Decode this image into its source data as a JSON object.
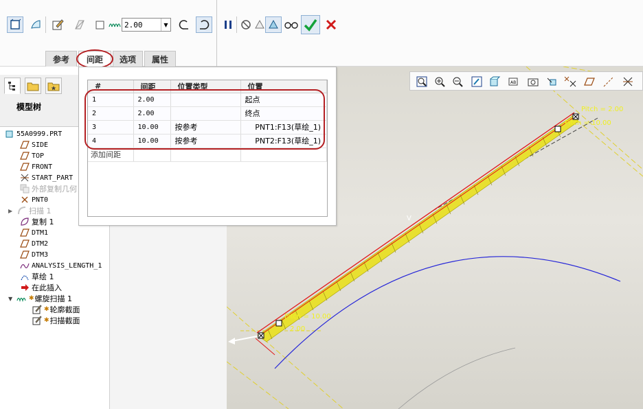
{
  "dashboard": {
    "pitch_value": "2.00",
    "tabs": [
      {
        "label": "参考"
      },
      {
        "label": "间距"
      },
      {
        "label": "选项"
      },
      {
        "label": "属性"
      }
    ]
  },
  "model_tree": {
    "title": "模型树",
    "items": [
      {
        "label": "55A0999.PRT",
        "icon": "part-icon"
      },
      {
        "label": "SIDE",
        "icon": "datum-plane-icon"
      },
      {
        "label": "TOP",
        "icon": "datum-plane-icon"
      },
      {
        "label": "FRONT",
        "icon": "datum-plane-icon"
      },
      {
        "label": "START_PART",
        "icon": "coordinate-system-icon"
      },
      {
        "label": "外部复制几何",
        "icon": "copy-geometry-icon"
      },
      {
        "label": "PNT0",
        "icon": "datum-point-icon"
      },
      {
        "label": "扫描 1",
        "icon": "sweep-icon"
      },
      {
        "label": "复制 1",
        "icon": "copy-icon"
      },
      {
        "label": "DTM1",
        "icon": "datum-plane-icon"
      },
      {
        "label": "DTM2",
        "icon": "datum-plane-icon"
      },
      {
        "label": "DTM3",
        "icon": "datum-plane-icon"
      },
      {
        "label": "ANALYSIS_LENGTH_1",
        "icon": "analysis-icon"
      },
      {
        "label": "草绘 1",
        "icon": "sketch-icon"
      },
      {
        "label": "在此插入",
        "icon": "insert-here-icon"
      },
      {
        "label": "螺旋扫描 1",
        "icon": "helical-sweep-icon"
      },
      {
        "label": "轮廓截面",
        "icon": "sketch-edit-icon"
      },
      {
        "label": "扫描截面",
        "icon": "sketch-edit-icon"
      }
    ]
  },
  "spacing_panel": {
    "columns": [
      "#",
      "间距",
      "位置类型",
      "位置"
    ],
    "rows": [
      {
        "num": "1",
        "pitch": "2.00",
        "loc_type": "",
        "location": "起点"
      },
      {
        "num": "2",
        "pitch": "2.00",
        "loc_type": "",
        "location": "终点"
      },
      {
        "num": "3",
        "pitch": "10.00",
        "loc_type": "按参考",
        "location": "PNT1:F13(草绘_1)"
      },
      {
        "num": "4",
        "pitch": "10.00",
        "loc_type": "按参考",
        "location": "PNT2:F13(草绘_1)"
      }
    ],
    "add_label": "添加间距"
  },
  "viewport": {
    "label_pitch_top": "Pitch = 2.00",
    "label_pitch_top2": "Pitch = 10.00",
    "label_pitch_bottom": "Pitch = 10.00",
    "label_pitch_bottom2": "2.00",
    "label_v": "V"
  }
}
